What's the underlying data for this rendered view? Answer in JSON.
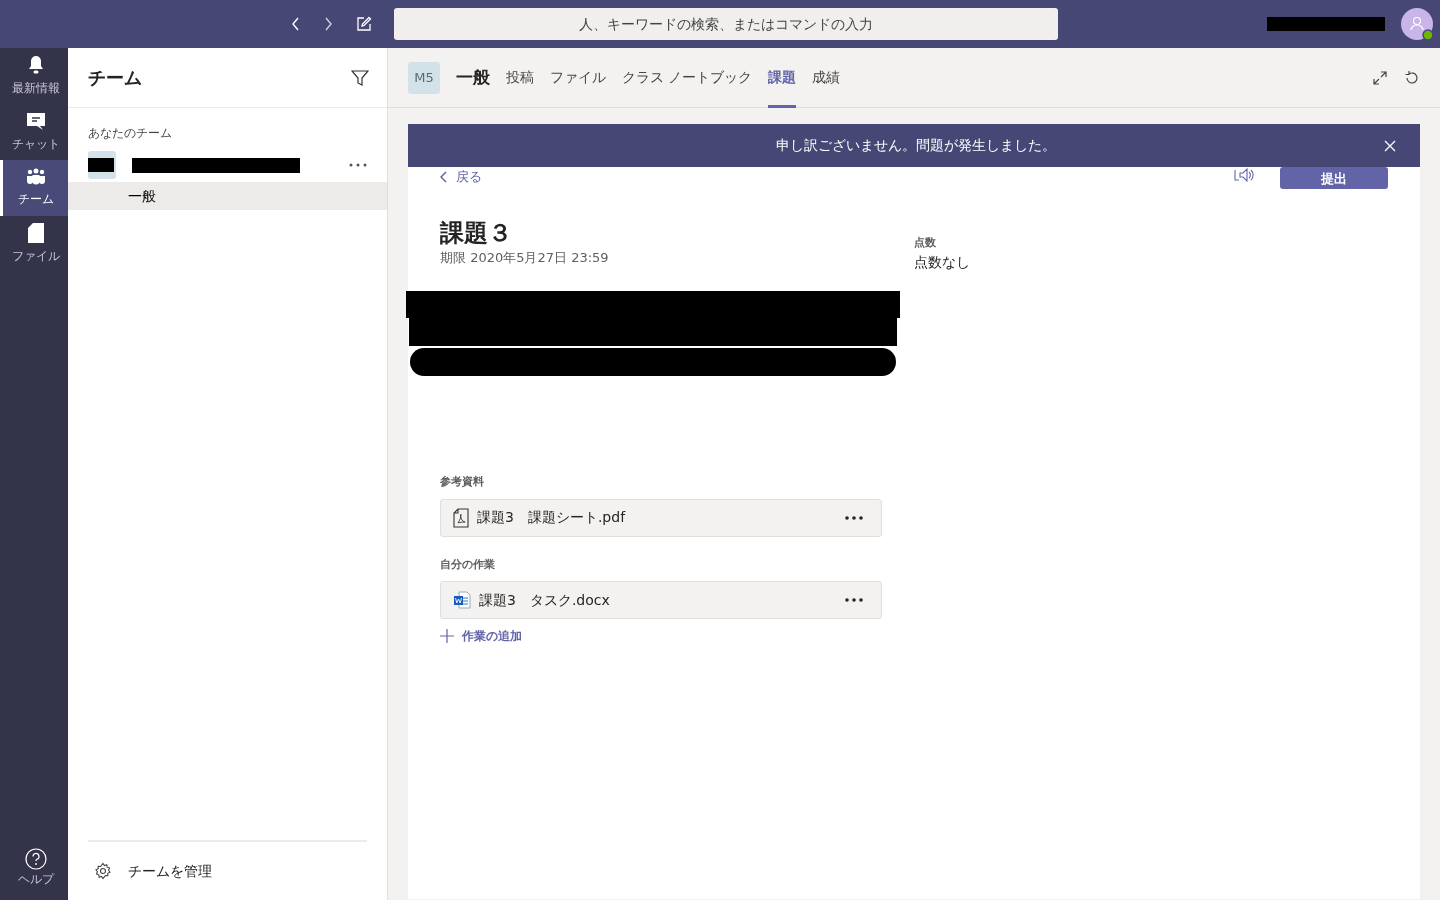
{
  "top_bar": {
    "search": {
      "placeholder": "人、キーワードの検索、またはコマンドの入力"
    }
  },
  "app_bar": {
    "items": [
      {
        "label": "最新情報",
        "kind": "bell",
        "selected": false
      },
      {
        "label": "チャット",
        "kind": "chat",
        "selected": false
      },
      {
        "label": "チーム",
        "kind": "teams",
        "selected": true
      },
      {
        "label": "ファイル",
        "kind": "file",
        "selected": false
      }
    ],
    "help": {
      "label": "ヘルプ"
    }
  },
  "teams_panel": {
    "title": "チーム",
    "section": "あなたのチーム",
    "channels": [
      {
        "label": "一般",
        "selected": true
      }
    ],
    "manage": "チームを管理"
  },
  "channel_header": {
    "avatar": "M5",
    "title": "一般",
    "tabs": [
      {
        "label": "投稿",
        "selected": false
      },
      {
        "label": "ファイル",
        "selected": false
      },
      {
        "label": "クラス ノートブック",
        "selected": false
      },
      {
        "label": "課題",
        "selected": true
      },
      {
        "label": "成績",
        "selected": false
      }
    ]
  },
  "banner": {
    "message": "申し訳ございません。問題が発生しました。"
  },
  "assignment": {
    "back": "戻る",
    "submit": "提出",
    "title": "課題３",
    "due": "期限 2020年5月27日 23:59",
    "points_label": "点数",
    "points": "点数なし",
    "reference_label": "参考資料",
    "references": [
      {
        "name": "課題3　課題シート.pdf",
        "kind": "pdf"
      }
    ],
    "my_work_label": "自分の作業",
    "my_work": [
      {
        "name": "課題3　タスク.docx",
        "kind": "word"
      }
    ],
    "add_work": "作業の追加"
  }
}
